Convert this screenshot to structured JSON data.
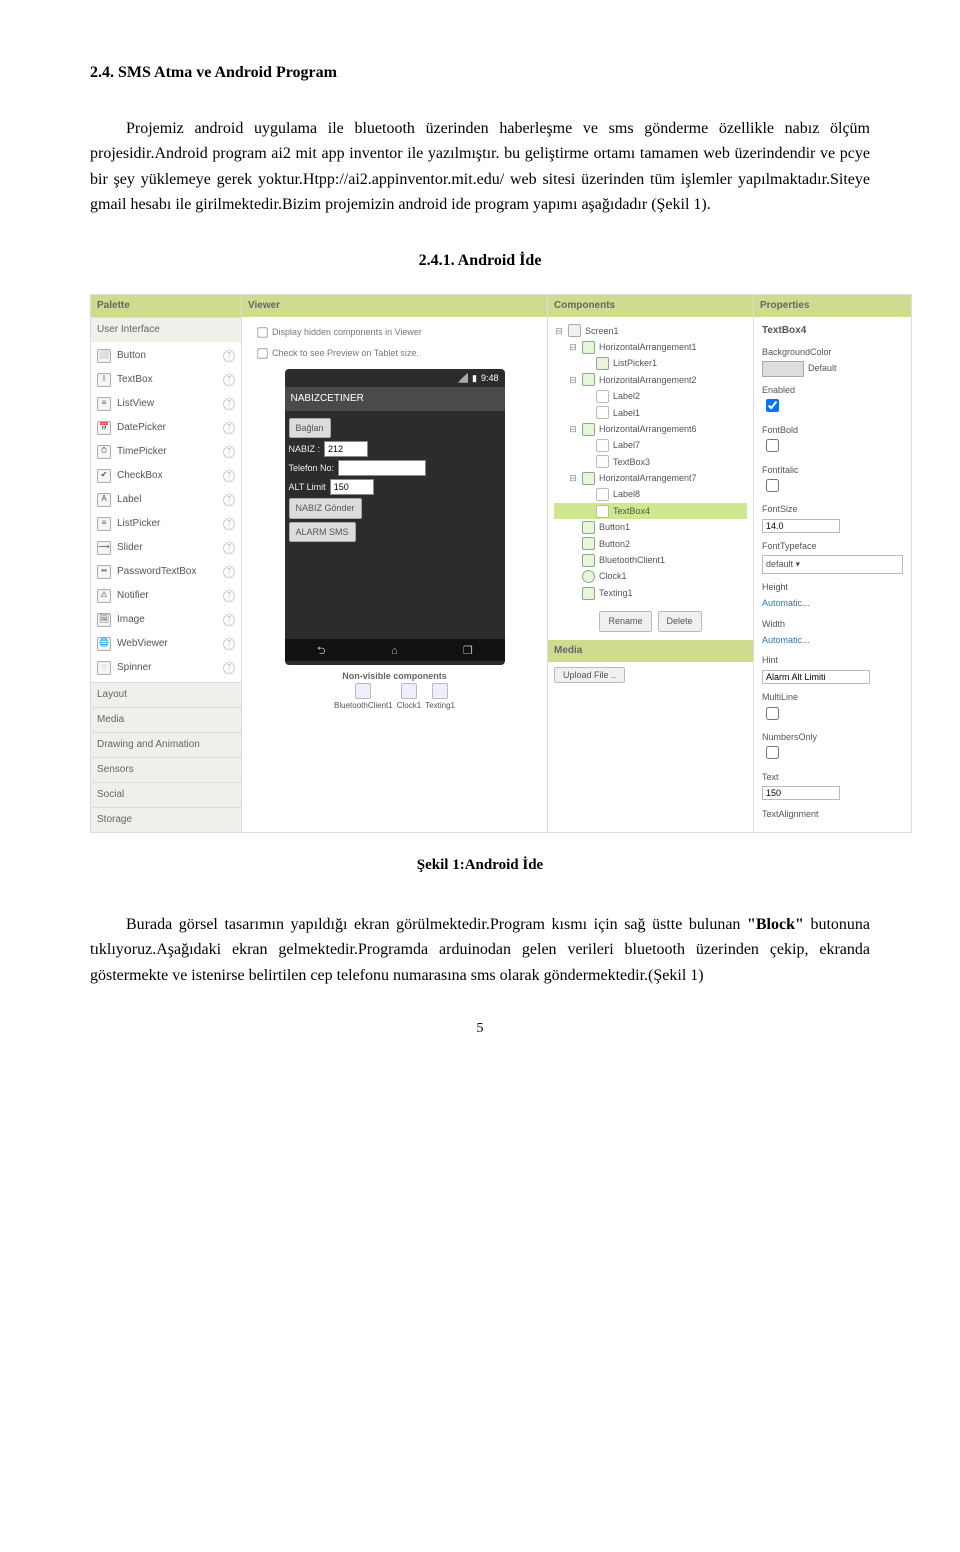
{
  "doc": {
    "heading": "2.4. SMS Atma ve Android Program",
    "para1": "Projemiz android uygulama ile bluetooth üzerinden haberleşme ve sms gönderme özellikle nabız ölçüm projesidir.Android program ai2 mit app inventor ile yazılmıştır. bu geliştirme ortamı tamamen web üzerindendir ve pcye bir şey yüklemeye gerek yoktur.Htpp://ai2.appinventor.mit.edu/ web sitesi üzerinden tüm işlemler yapılmaktadır.Siteye gmail hesabı ile girilmektedir.Bizim projemizin android ide program yapımı aşağıdadır (Şekil 1).",
    "subheading": "2.4.1. Android İde",
    "figcaption": "Şekil 1:Android İde",
    "para2": "Burada görsel tasarımın yapıldığı ekran görülmektedir.Program kısmı için sağ üstte bulunan \"Block\" butonuna tıklıyoruz.Aşağıdaki ekran gelmektedir.Programda arduinodan gelen verileri bluetooth üzerinden çekip, ekranda göstermekte ve istenirse belirtilen cep telefonu numarasına sms olarak göndermektedir.(Şekil 1)",
    "page": "5"
  },
  "cols": {
    "palette": "Palette",
    "viewer": "Viewer",
    "components": "Components",
    "properties": "Properties"
  },
  "palette": {
    "section_ui": "User Interface",
    "items": [
      {
        "icon": "⬜",
        "name": "Button"
      },
      {
        "icon": "I",
        "name": "TextBox"
      },
      {
        "icon": "≡",
        "name": "ListView"
      },
      {
        "icon": "📅",
        "name": "DatePicker"
      },
      {
        "icon": "⏱",
        "name": "TimePicker"
      },
      {
        "icon": "✔",
        "name": "CheckBox"
      },
      {
        "icon": "A",
        "name": "Label"
      },
      {
        "icon": "≡",
        "name": "ListPicker"
      },
      {
        "icon": "⟿",
        "name": "Slider"
      },
      {
        "icon": "••",
        "name": "PasswordTextBox"
      },
      {
        "icon": "⚠",
        "name": "Notifier"
      },
      {
        "icon": "🖼",
        "name": "Image"
      },
      {
        "icon": "🌐",
        "name": "WebViewer"
      },
      {
        "icon": "◌",
        "name": "Spinner"
      }
    ],
    "sections": [
      "Layout",
      "Media",
      "Drawing and Animation",
      "Sensors",
      "Social",
      "Storage"
    ]
  },
  "viewer": {
    "chk1": "Display hidden components in Viewer",
    "chk2": "Check to see Preview on Tablet size.",
    "time": "9:48",
    "app_title": "NABIZCETINER",
    "btn_baglan": "Bağlan",
    "lbl_nabiz": "NABIZ :",
    "val_nabiz": "212",
    "lbl_tel": "Telefon No:",
    "lbl_alt": "ALT Limit",
    "val_alt": "150",
    "btn_gonder": "NABIZ Gönder",
    "btn_alarm": "ALARM SMS",
    "nonvis_label": "Non-visible components",
    "nonvis": [
      "BluetoothClient1",
      "Clock1",
      "Texting1"
    ]
  },
  "components": {
    "tree": [
      {
        "depth": 0,
        "tw": "⊟",
        "cls": "screen",
        "label": "Screen1"
      },
      {
        "depth": 1,
        "tw": "⊟",
        "cls": "",
        "label": "HorizontalArrangement1"
      },
      {
        "depth": 2,
        "tw": "",
        "cls": "",
        "label": "ListPicker1"
      },
      {
        "depth": 1,
        "tw": "⊟",
        "cls": "",
        "label": "HorizontalArrangement2"
      },
      {
        "depth": 2,
        "tw": "",
        "cls": "text",
        "label": "Label2"
      },
      {
        "depth": 2,
        "tw": "",
        "cls": "text",
        "label": "Label1"
      },
      {
        "depth": 1,
        "tw": "⊟",
        "cls": "",
        "label": "HorizontalArrangement6"
      },
      {
        "depth": 2,
        "tw": "",
        "cls": "text",
        "label": "Label7"
      },
      {
        "depth": 2,
        "tw": "",
        "cls": "text",
        "label": "TextBox3"
      },
      {
        "depth": 1,
        "tw": "⊟",
        "cls": "",
        "label": "HorizontalArrangement7"
      },
      {
        "depth": 2,
        "tw": "",
        "cls": "text",
        "label": "Label8"
      },
      {
        "depth": 2,
        "tw": "",
        "cls": "text",
        "label": "TextBox4",
        "selected": true
      },
      {
        "depth": 1,
        "tw": "",
        "cls": "",
        "label": "Button1"
      },
      {
        "depth": 1,
        "tw": "",
        "cls": "",
        "label": "Button2"
      },
      {
        "depth": 1,
        "tw": "",
        "cls": "",
        "label": "BluetoothClient1"
      },
      {
        "depth": 1,
        "tw": "",
        "cls": "clock",
        "label": "Clock1"
      },
      {
        "depth": 1,
        "tw": "",
        "cls": "",
        "label": "Texting1"
      }
    ],
    "rename": "Rename",
    "delete": "Delete",
    "media": "Media",
    "upload": "Upload File .."
  },
  "props": {
    "name": "TextBox4",
    "bgcolor_label": "BackgroundColor",
    "bgcolor_value": "Default",
    "enabled_label": "Enabled",
    "fontbold_label": "FontBold",
    "fontitalic_label": "FontItalic",
    "fontsize_label": "FontSize",
    "fontsize_value": "14.0",
    "typeface_label": "FontTypeface",
    "typeface_value": "default ▾",
    "height_label": "Height",
    "height_value": "Automatic...",
    "width_label": "Width",
    "width_value": "Automatic...",
    "hint_label": "Hint",
    "hint_value": "Alarm Alt Limiti",
    "multiline_label": "MultiLine",
    "numbers_label": "NumbersOnly",
    "text_label": "Text",
    "text_value": "150",
    "textalign_label": "TextAlignment"
  }
}
